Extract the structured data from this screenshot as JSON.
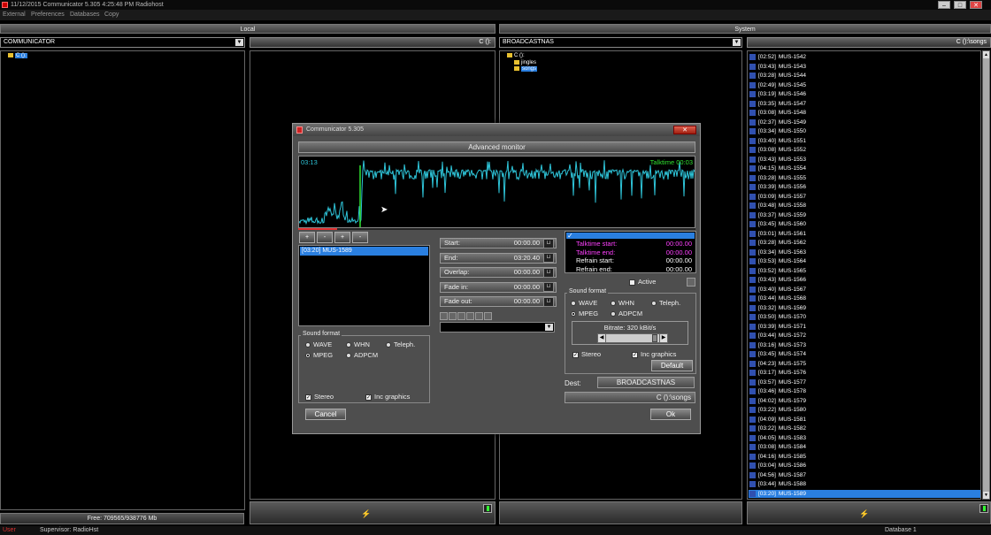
{
  "titlebar": {
    "text": "11/12/2015   Communicator 5.305    4:25:48 PM   Radiohost",
    "btn_min": "–",
    "btn_max": "□",
    "btn_close": "✕"
  },
  "menu": [
    "External",
    "Preferences",
    "Databases",
    "Copy"
  ],
  "headers": {
    "local": "Local",
    "system": "System"
  },
  "local": {
    "combo": "COMMUNICATOR",
    "path": "C ():",
    "tree_root": "C ():",
    "free": "Free: 709565/938776 Mb"
  },
  "system": {
    "combo": "BROADCASTNAS",
    "path": "C ():\\songs",
    "tree": [
      "C ():",
      "jingles",
      "songs"
    ]
  },
  "songs": [
    {
      "time": "02:52",
      "name": "MUS-1542"
    },
    {
      "time": "03:43",
      "name": "MUS-1543"
    },
    {
      "time": "03:28",
      "name": "MUS-1544"
    },
    {
      "time": "02:49",
      "name": "MUS-1545"
    },
    {
      "time": "03:19",
      "name": "MUS-1546"
    },
    {
      "time": "03:35",
      "name": "MUS-1547"
    },
    {
      "time": "03:08",
      "name": "MUS-1548"
    },
    {
      "time": "02:37",
      "name": "MUS-1549"
    },
    {
      "time": "03:34",
      "name": "MUS-1550"
    },
    {
      "time": "03:40",
      "name": "MUS-1551"
    },
    {
      "time": "03:08",
      "name": "MUS-1552"
    },
    {
      "time": "03:43",
      "name": "MUS-1553"
    },
    {
      "time": "04:15",
      "name": "MUS-1554"
    },
    {
      "time": "03:28",
      "name": "MUS-1555"
    },
    {
      "time": "03:39",
      "name": "MUS-1556"
    },
    {
      "time": "03:09",
      "name": "MUS-1557"
    },
    {
      "time": "03:48",
      "name": "MUS-1558"
    },
    {
      "time": "03:37",
      "name": "MUS-1559"
    },
    {
      "time": "03:45",
      "name": "MUS-1560"
    },
    {
      "time": "03:01",
      "name": "MUS-1561"
    },
    {
      "time": "03:28",
      "name": "MUS-1562"
    },
    {
      "time": "03:34",
      "name": "MUS-1563"
    },
    {
      "time": "03:53",
      "name": "MUS-1564"
    },
    {
      "time": "03:52",
      "name": "MUS-1565"
    },
    {
      "time": "03:43",
      "name": "MUS-1566"
    },
    {
      "time": "03:40",
      "name": "MUS-1567"
    },
    {
      "time": "03:44",
      "name": "MUS-1568"
    },
    {
      "time": "03:32",
      "name": "MUS-1569"
    },
    {
      "time": "03:50",
      "name": "MUS-1570"
    },
    {
      "time": "03:39",
      "name": "MUS-1571"
    },
    {
      "time": "03:44",
      "name": "MUS-1572"
    },
    {
      "time": "03:16",
      "name": "MUS-1573"
    },
    {
      "time": "03:45",
      "name": "MUS-1574"
    },
    {
      "time": "04:23",
      "name": "MUS-1575"
    },
    {
      "time": "03:17",
      "name": "MUS-1576"
    },
    {
      "time": "03:57",
      "name": "MUS-1577"
    },
    {
      "time": "03:46",
      "name": "MUS-1578"
    },
    {
      "time": "04:02",
      "name": "MUS-1579"
    },
    {
      "time": "03:22",
      "name": "MUS-1580"
    },
    {
      "time": "04:09",
      "name": "MUS-1581"
    },
    {
      "time": "03:22",
      "name": "MUS-1582"
    },
    {
      "time": "04:05",
      "name": "MUS-1583"
    },
    {
      "time": "03:08",
      "name": "MUS-1584"
    },
    {
      "time": "04:16",
      "name": "MUS-1585"
    },
    {
      "time": "03:04",
      "name": "MUS-1586"
    },
    {
      "time": "04:56",
      "name": "MUS-1587"
    },
    {
      "time": "03:44",
      "name": "MUS-1588"
    },
    {
      "time": "03:20",
      "name": "MUS-1589"
    }
  ],
  "selected_song_index": 47,
  "status": {
    "user_label": "User",
    "supervisor": "Supervisor: RadioHst",
    "database": "Database 1"
  },
  "dialog": {
    "title": "Communicator 5.305",
    "close": "✕",
    "header": "Advanced monitor",
    "wave_time": "03:13",
    "talktime": "Talktime 00:03",
    "zoom_buttons": [
      "+",
      "-",
      "+",
      "-"
    ],
    "track": "[03:20] MUS-1589",
    "fields": [
      {
        "label": "Start:",
        "value": "00:00.00"
      },
      {
        "label": "End:",
        "value": "03:20.40"
      },
      {
        "label": "Overlap:",
        "value": "00:00.00"
      },
      {
        "label": "Fade in:",
        "value": "00:00.00"
      },
      {
        "label": "Fade out:",
        "value": "00:00.00"
      }
    ],
    "lock": "⊔",
    "info": [
      {
        "label": "Talktime start:",
        "value": "00:00.00",
        "color": "#ff40ff"
      },
      {
        "label": "Talktime end:",
        "value": "00:00.00",
        "color": "#ff40ff"
      },
      {
        "label": "Refrain start:",
        "value": "00:00.00",
        "color": "#ffffff"
      },
      {
        "label": "Refrain end:",
        "value": "00:00.00",
        "color": "#ffffff"
      }
    ],
    "active_label": "Active",
    "sound_format": "Sound format",
    "formats": [
      "WAVE",
      "WHN",
      "Teleph.",
      "MPEG",
      "ADPCM"
    ],
    "selected_format": "MPEG",
    "stereo": "Stereo",
    "inc_graphics": "Inc graphics",
    "bitrate": "Bitrate: 320 kBit/s",
    "bitrate_fraction": 0.88,
    "default": "Default",
    "dest_label": "Dest:",
    "dest_value": "BROADCASTNAS",
    "dest_path": "C ():\\songs",
    "cancel": "Cancel",
    "ok": "Ok"
  },
  "colors": {
    "selection": "#2a7fe0",
    "wave": "#2ec4d8",
    "marker": "#30e030",
    "talktime": "#30e030"
  }
}
